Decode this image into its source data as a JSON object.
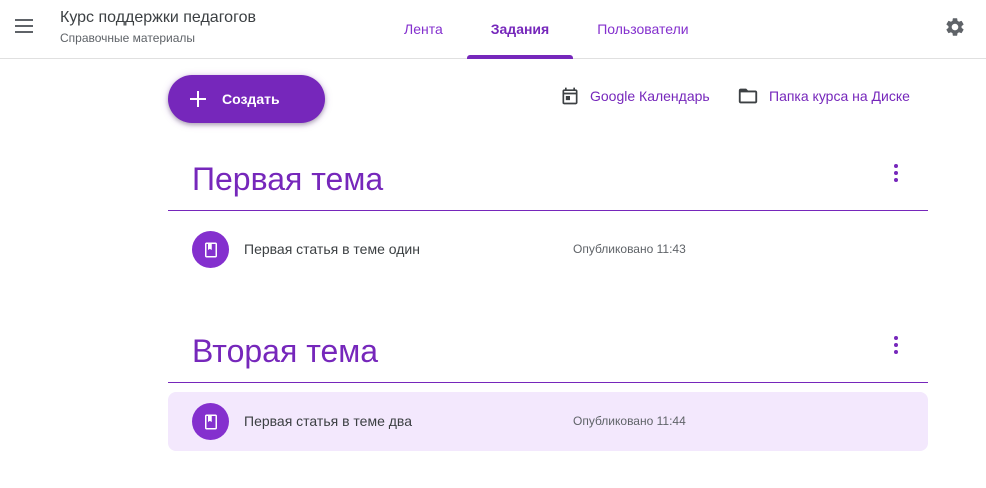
{
  "header": {
    "course_title": "Курс поддержки педагогов",
    "course_subtitle": "Справочные материалы",
    "tabs": [
      {
        "label": "Лента",
        "active": false
      },
      {
        "label": "Задания",
        "active": true
      },
      {
        "label": "Пользователи",
        "active": false
      }
    ],
    "icons": {
      "menu": "hamburger-menu-icon",
      "settings": "gear-icon"
    }
  },
  "actions": {
    "create_label": "Создать",
    "calendar_label": "Google Календарь",
    "drive_label": "Папка курса на Диске"
  },
  "topics": [
    {
      "title": "Первая тема",
      "items": [
        {
          "title": "Первая статья в теме один",
          "status": "Опубликовано 11:43",
          "highlighted": false
        }
      ]
    },
    {
      "title": "Вторая тема",
      "items": [
        {
          "title": "Первая статья в теме два",
          "status": "Опубликовано 11:44",
          "highlighted": true
        }
      ]
    }
  ],
  "colors": {
    "accent": "#7627bb",
    "accent_light": "#8430ce",
    "highlight_bg": "#f3e8fd",
    "text": "#3c4043",
    "secondary_text": "#5f6368"
  }
}
